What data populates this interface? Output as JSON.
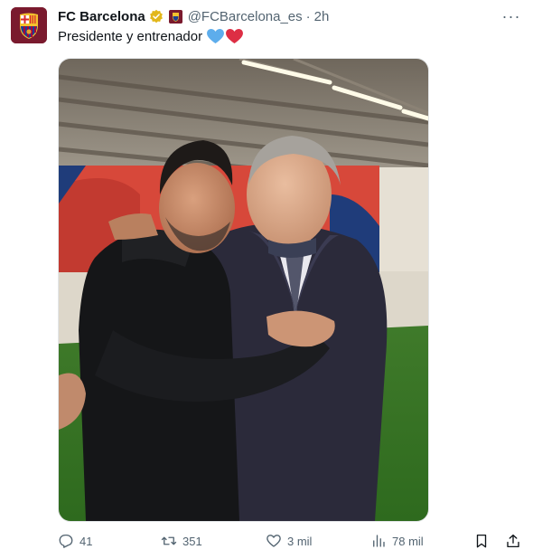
{
  "account": {
    "name": "FC Barcelona",
    "handle": "@FCBarcelona_es",
    "separator": "·",
    "time": "2h",
    "verified_color": "#e2b719",
    "brand_color": "#7a1a2e"
  },
  "tweet": {
    "text": "Presidente y entrenador",
    "emojis": [
      "blue-heart",
      "red-heart"
    ]
  },
  "more_label": "···",
  "actions": {
    "reply_count": "41",
    "retweet_count": "351",
    "like_count": "3 mil",
    "views_count": "78 mil"
  },
  "icons": [
    "reply-icon",
    "retweet-icon",
    "like-icon",
    "views-icon",
    "bookmark-icon",
    "share-icon"
  ]
}
